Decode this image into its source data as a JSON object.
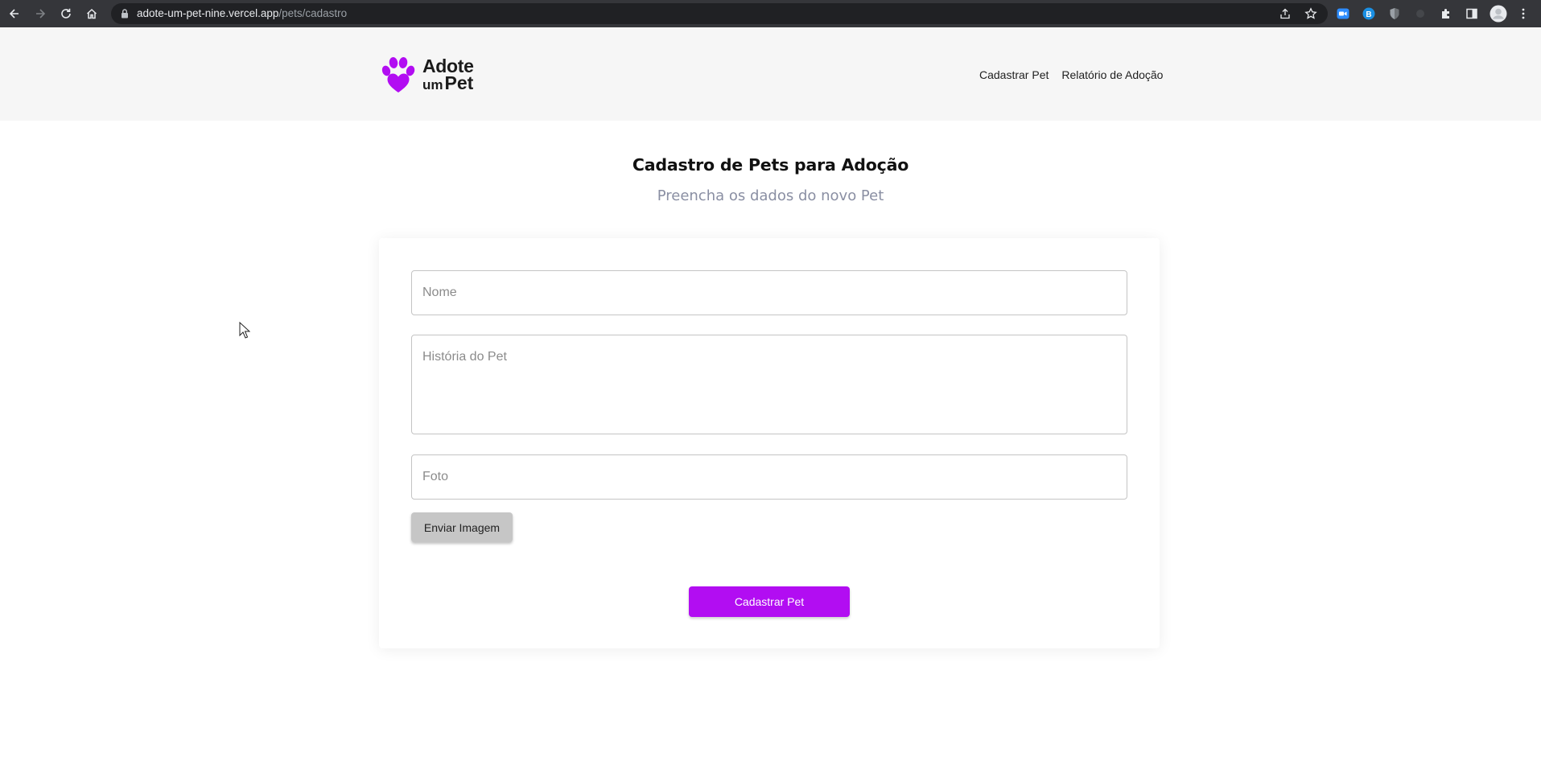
{
  "browser": {
    "url_domain": "adote-um-pet-nine.vercel.app",
    "url_path": "/pets/cadastro",
    "icons": [
      "back-icon",
      "forward-icon",
      "reload-icon",
      "home-icon",
      "lock-icon",
      "share-icon",
      "bookmark-star-icon",
      "zoom-extension-icon",
      "b-extension-icon",
      "shield-extension-icon",
      "extensions-puzzle-icon",
      "side-panel-icon",
      "profile-avatar-icon",
      "more-menu-icon"
    ]
  },
  "header": {
    "logo": {
      "line1": "Adote",
      "line2_small": "um",
      "line2_large": "Pet"
    },
    "nav": [
      {
        "label": "Cadastrar Pet"
      },
      {
        "label": "Relatório de Adoção"
      }
    ]
  },
  "main": {
    "title": "Cadastro de Pets para Adoção",
    "subtitle": "Preencha os dados do novo Pet"
  },
  "form": {
    "nome": {
      "placeholder": "Nome",
      "value": ""
    },
    "historia": {
      "placeholder": "História do Pet",
      "value": ""
    },
    "foto": {
      "placeholder": "Foto",
      "value": ""
    },
    "upload_label": "Enviar Imagem",
    "submit_label": "Cadastrar Pet"
  },
  "colors": {
    "brand": "#b20df2",
    "header_bg": "#f6f6f6",
    "subtitle": "#8a8fa3",
    "upload_button_bg": "#c6c6c6"
  }
}
